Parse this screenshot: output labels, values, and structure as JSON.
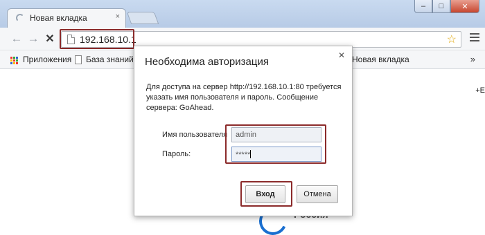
{
  "browser": {
    "tab_title": "Новая вкладка",
    "tab_close": "×",
    "window_controls": {
      "minimize": "–",
      "maximize": "□",
      "close": "✕"
    },
    "url": "192.168.10.1"
  },
  "toolbar": {
    "back": "←",
    "forward": "→",
    "stop": "✕",
    "star": "☆"
  },
  "bookmarks": {
    "apps_label": "Приложения",
    "items": [
      "База знаний U",
      "Новая вкладка"
    ],
    "more": "»"
  },
  "content": {
    "side_mark": "+E",
    "logo_text": "Россия"
  },
  "dialog": {
    "title": "Необходима авторизация",
    "close": "✕",
    "message": "Для доступа на сервер http://192.168.10.1:80 требуется указать имя пользователя и пароль. Сообщение сервера: GoAhead.",
    "username_label": "Имя пользователя",
    "username_value": "admin",
    "password_label": "Пароль:",
    "password_value": "*****",
    "login_button": "Вход",
    "cancel_button": "Отмена"
  },
  "colors": {
    "highlight_border": "#8b2a2a",
    "star": "#e0a400",
    "logo_blue": "#1a6fd0"
  }
}
